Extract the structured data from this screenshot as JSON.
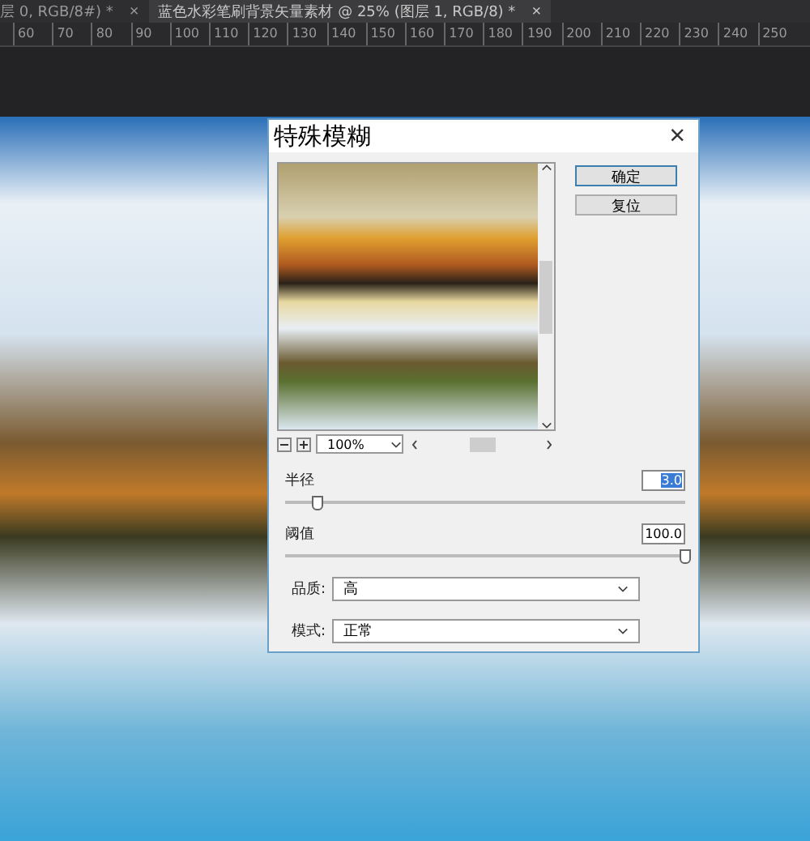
{
  "tabs": [
    {
      "label": "层 0, RGB/8#) *",
      "selected": false,
      "close": "×"
    },
    {
      "label": "蓝色水彩笔刷背景矢量素材 @ 25% (图层 1, RGB/8) *",
      "selected": true,
      "close": "×"
    }
  ],
  "ruler": [
    "60",
    "70",
    "80",
    "90",
    "100",
    "110",
    "120",
    "130",
    "140",
    "150",
    "160",
    "170",
    "180",
    "190",
    "200",
    "210",
    "220",
    "230",
    "240",
    "250"
  ],
  "dialog": {
    "title": "特殊模糊",
    "close": "×",
    "buttons": [
      {
        "label": "确定",
        "primary": true
      },
      {
        "label": "复位",
        "primary": false
      }
    ],
    "zoom": "100%",
    "sliders": [
      {
        "label": "半径",
        "value": "3.0",
        "highlighted": true,
        "level": 0.08
      },
      {
        "label": "阈值",
        "value": "100.0",
        "highlighted": false,
        "level": 1
      }
    ],
    "selects": [
      {
        "label": "品质:",
        "value": "高"
      },
      {
        "label": "模式:",
        "value": "正常"
      }
    ]
  }
}
